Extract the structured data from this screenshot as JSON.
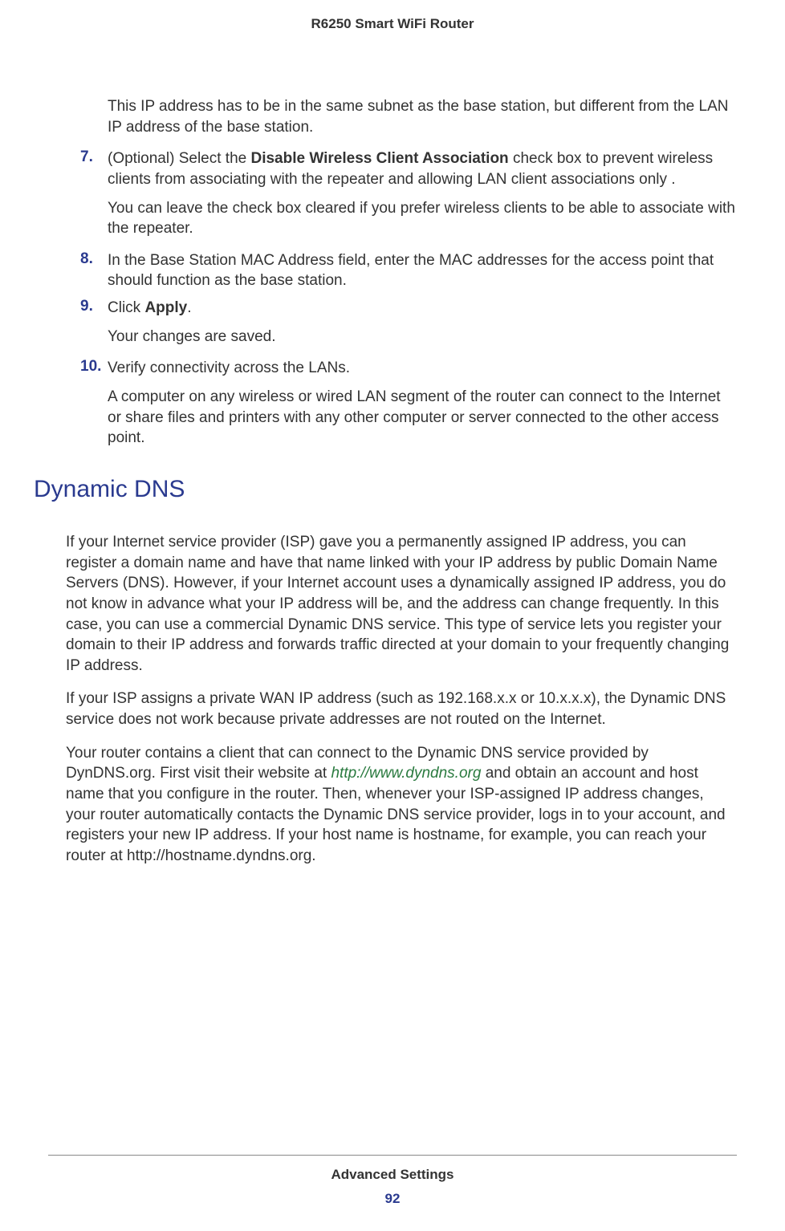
{
  "header": {
    "title": "R6250 Smart WiFi Router"
  },
  "intro": {
    "text": "This IP address has to be in the same subnet as the base station, but different from the LAN IP address of the base station."
  },
  "steps": {
    "s7": {
      "num": "7.",
      "pre": "(Optional) Select the ",
      "bold": "Disable Wireless Client Association",
      "post": " check box to prevent wireless clients from associating with the repeater and allowing LAN client associations only  .",
      "follow": "You can leave the check box cleared if you prefer wireless clients to be able to associate with the repeater."
    },
    "s8": {
      "num": "8.",
      "text": "In the Base Station MAC  Address field, enter the MAC addresses for the access point that should function as the base station."
    },
    "s9": {
      "num": "9.",
      "pre": "Click ",
      "bold": "Apply",
      "post": ".",
      "follow": "Your changes are saved."
    },
    "s10": {
      "num": "10.",
      "text": "Verify connectivity across the LANs.",
      "follow": "A computer on any wireless or wired LAN segment of the router can connect to the Internet or share files and printers with any other computer or server connected to the other access point."
    }
  },
  "section": {
    "heading": "Dynamic DNS",
    "p1": "If your Internet service provider (ISP) gave you a permanently assigned IP address, you can register a domain name and have that name linked with your IP address by public Domain Name Servers (DNS). However, if your Internet account uses a dynamically assigned IP address, you do not know in advance what your IP address will be, and the address can change frequently. In this case, you can use a commercial Dynamic DNS service. This type of service lets you register your domain to their IP address and forwards traffic directed at your domain to your frequently changing IP address.",
    "p2": "If your ISP assigns a private WAN IP address (such as 192.168.x.x or 10.x.x.x), the Dynamic DNS service does not work because private addresses are not routed on the Internet.",
    "p3_pre": "Your router contains a client that can connect to the Dynamic DNS service provided by DynDNS.org. First visit their website at ",
    "p3_link": "http://www.dyndns.org",
    "p3_post": " and obtain an account and host name that you configure in the router. Then, whenever your ISP-assigned IP address changes, your router automatically contacts the Dynamic DNS service provider, logs in to your account, and registers your new IP address. If your host name is hostname, for example, you can reach your router at http://hostname.dyndns.org."
  },
  "footer": {
    "section": "Advanced Settings",
    "page": "92"
  }
}
